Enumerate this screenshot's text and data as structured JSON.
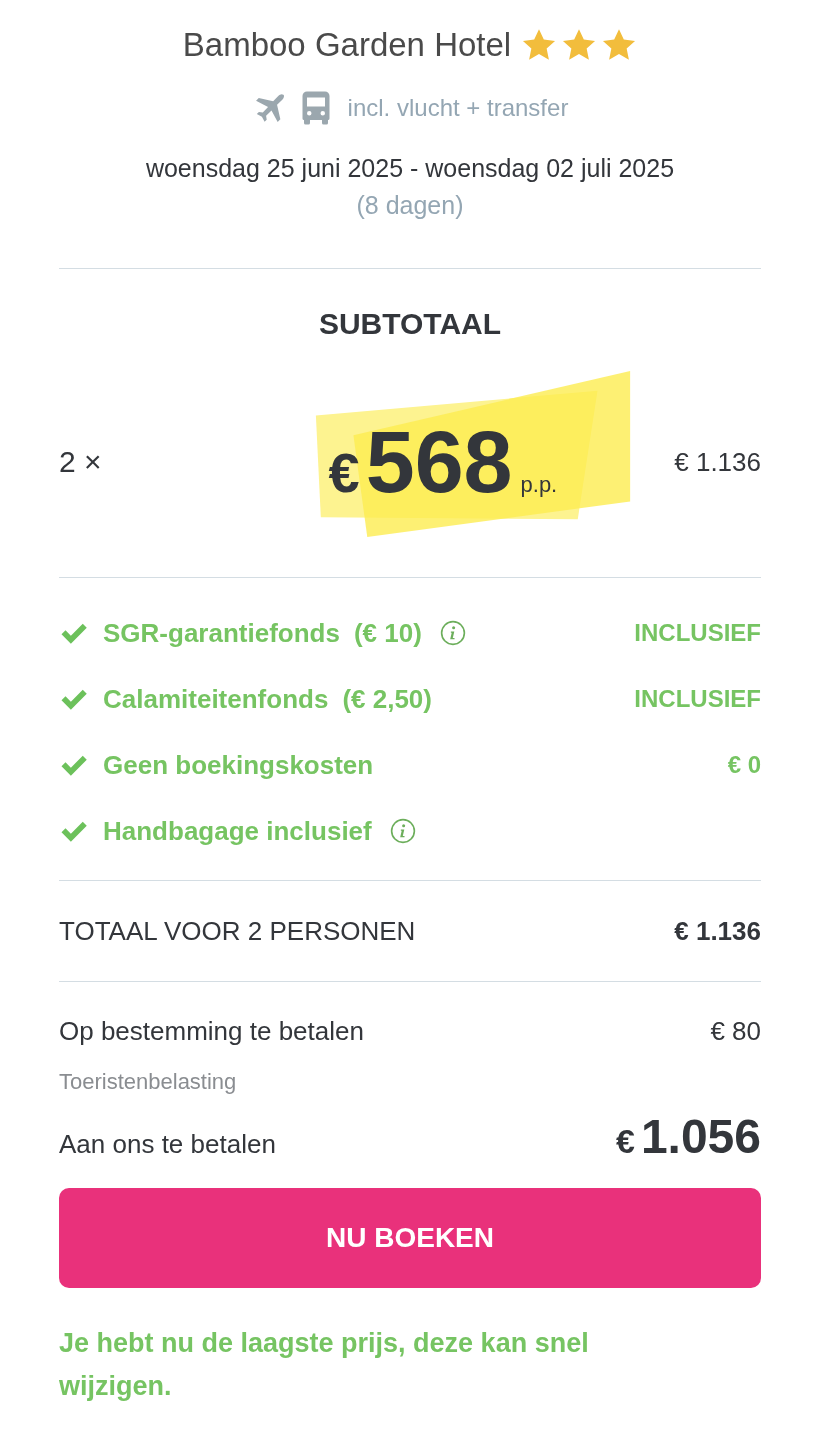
{
  "hotel": {
    "name": "Bamboo Garden Hotel",
    "stars": 3
  },
  "travel": {
    "text": "incl. vlucht + transfer"
  },
  "dates": {
    "range": "woensdag 25 juni 2025 - woensdag 02 juli 2025",
    "duration": "(8 dagen)"
  },
  "subtotal": {
    "title": "SUBTOTAAL",
    "quantity": "2 ×",
    "currency": "€",
    "price": "568",
    "unit": "p.p.",
    "total": "€ 1.136"
  },
  "items": [
    {
      "label": "SGR-garantiefonds",
      "amount": "(€ 10)",
      "info": true,
      "value": "INCLUSIEF"
    },
    {
      "label": "Calamiteitenfonds",
      "amount": "(€ 2,50)",
      "info": false,
      "value": "INCLUSIEF"
    },
    {
      "label": "Geen boekingskosten",
      "info": false,
      "value": "€ 0"
    },
    {
      "label": "Handbagage inclusief",
      "info": true
    }
  ],
  "total": {
    "label": "TOTAAL VOOR 2 PERSONEN",
    "value": "€ 1.136"
  },
  "destination": {
    "label": "Op bestemming te betalen",
    "value": "€ 80",
    "note": "Toeristenbelasting"
  },
  "pay": {
    "label": "Aan ons te betalen",
    "currency": "€",
    "value": "1.056"
  },
  "button": "NU BOEKEN",
  "notice": "Je hebt nu de laagste prijs, deze kan snel wijzigen."
}
